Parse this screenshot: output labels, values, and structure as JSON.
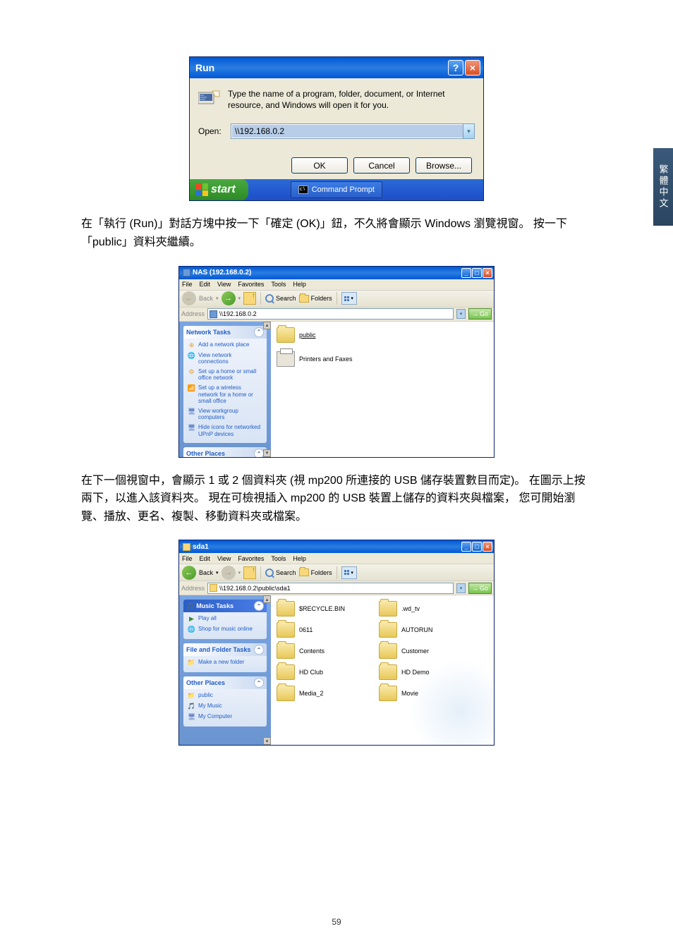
{
  "side_tab": "繁體中文",
  "run_dialog": {
    "title": "Run",
    "description": "Type the name of a program, folder, document, or Internet resource, and Windows will open it for you.",
    "open_label": "Open:",
    "open_value": "\\\\192.168.0.2",
    "ok_label": "OK",
    "cancel_label": "Cancel",
    "browse_label": "Browse..."
  },
  "taskbar": {
    "start_label": "start",
    "cmd_item": "Command Prompt"
  },
  "paragraph1": "在「執行 (Run)」對話方塊中按一下「確定 (OK)」鈕，不久將會顯示 Windows 瀏覽視窗。 按一下「public」資料夾繼續。",
  "explorer1": {
    "title": "NAS (192.168.0.2)",
    "menu": {
      "file": "File",
      "edit": "Edit",
      "view": "View",
      "favorites": "Favorites",
      "tools": "Tools",
      "help": "Help"
    },
    "toolbar": {
      "back": "Back",
      "search": "Search",
      "folders": "Folders"
    },
    "address_label": "Address",
    "address_value": "\\\\192.168.0.2",
    "go_label": "Go",
    "sidebar": {
      "network_tasks_header": "Network Tasks",
      "tasks": [
        "Add a network place",
        "View network connections",
        "Set up a home or small office network",
        "Set up a wireless network for a home or small office",
        "View workgroup computers",
        "Hide icons for networked UPnP devices"
      ],
      "other_places_header": "Other Places"
    },
    "items": {
      "public": "public",
      "printers": "Printers and Faxes"
    }
  },
  "paragraph2": "在下一個視窗中，會顯示 1 或 2 個資料夾 (視 mp200 所連接的 USB 儲存裝置數目而定)。 在圖示上按兩下，以進入該資料夾。 現在可檢視插入 mp200 的 USB 裝置上儲存的資料夾與檔案， 您可開始瀏覽、播放、更名、複製、移動資料夾或檔案。",
  "explorer2": {
    "title": "sda1",
    "menu": {
      "file": "File",
      "edit": "Edit",
      "view": "View",
      "favorites": "Favorites",
      "tools": "Tools",
      "help": "Help"
    },
    "toolbar": {
      "back": "Back",
      "search": "Search",
      "folders": "Folders"
    },
    "address_label": "Address",
    "address_value": "\\\\192.168.0.2\\public\\sda1",
    "go_label": "Go",
    "sidebar": {
      "music_tasks_header": "Music Tasks",
      "music_tasks": [
        "Play all",
        "Shop for music online"
      ],
      "file_tasks_header": "File and Folder Tasks",
      "file_tasks": [
        "Make a new folder"
      ],
      "other_places_header": "Other Places",
      "other_places": [
        "public",
        "My Music",
        "My Computer"
      ]
    },
    "items": [
      "$RECYCLE.BIN",
      ".wd_tv",
      "0611",
      "AUTORUN",
      "Contents",
      "Customer",
      "HD Club",
      "HD Demo",
      "Media_2",
      "Movie"
    ]
  },
  "page_number": "59"
}
